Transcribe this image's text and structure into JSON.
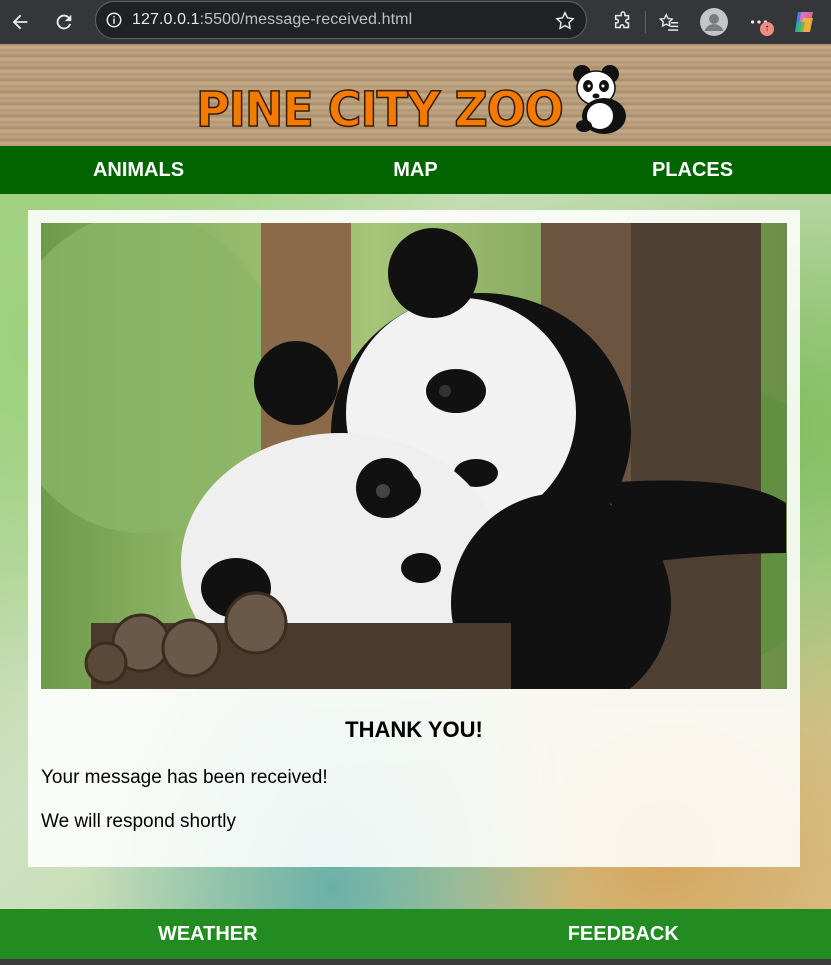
{
  "browser": {
    "url_host": "127.0.0.1",
    "url_path": ":5500/message-received.html",
    "icons": [
      "back-arrow-icon",
      "reload-icon",
      "site-info-icon",
      "bookmark-star-icon",
      "extensions-icon",
      "favorites-icon",
      "profile-avatar-icon",
      "more-menu-icon",
      "copilot-icon"
    ],
    "update_badge": "↑"
  },
  "site": {
    "logo_text": "PINE CITY ZOO",
    "nav": [
      "ANIMALS",
      "MAP",
      "PLACES"
    ],
    "footer_nav": [
      "WEATHER",
      "FEEDBACK"
    ]
  },
  "content": {
    "heading": "THANK YOU!",
    "line1": "Your message has been received!",
    "line2": "We will respond shortly"
  },
  "colors": {
    "nav_bg": "#006400",
    "footer_bg": "#228b22",
    "logo_orange": "#f47b00"
  }
}
